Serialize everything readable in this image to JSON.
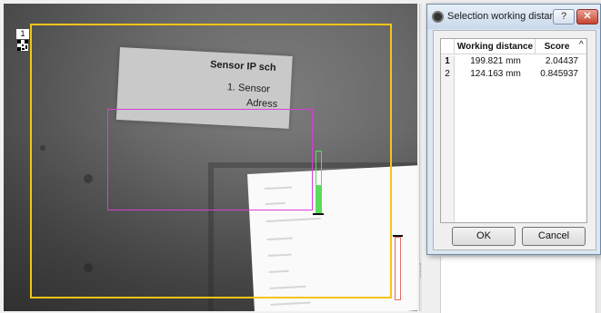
{
  "camera": {
    "frame_number": "1",
    "label_title": "Sensor IP sch",
    "label_line1": "1.   Sensor",
    "label_line2": "Adress",
    "green_gauge_level": 0.45,
    "red_gauge_level": 0.0
  },
  "dialog": {
    "title": "Selection working distan...",
    "help_label": "?",
    "close_label": "✕",
    "columns": {
      "working_distance": "Working distance",
      "score": "Score"
    },
    "sort_indicator": "^",
    "rows": [
      {
        "index": "1",
        "working_distance": "199.821 mm",
        "score": "2.04437"
      },
      {
        "index": "2",
        "working_distance": "124.163 mm",
        "score": "0.845937"
      }
    ],
    "ok_label": "OK",
    "cancel_label": "Cancel"
  }
}
